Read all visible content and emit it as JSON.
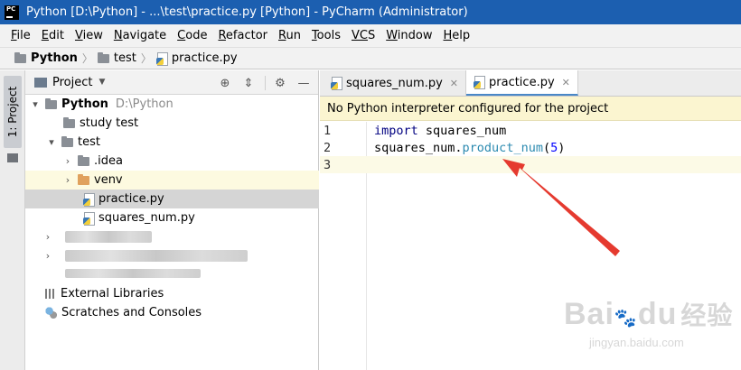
{
  "window": {
    "title": "Python [D:\\Python] - ...\\test\\practice.py [Python] - PyCharm (Administrator)",
    "app_icon_text": "PC"
  },
  "menu": [
    {
      "m": "F",
      "rest": "ile"
    },
    {
      "m": "E",
      "rest": "dit"
    },
    {
      "m": "V",
      "rest": "iew"
    },
    {
      "m": "N",
      "rest": "avigate"
    },
    {
      "m": "C",
      "rest": "ode"
    },
    {
      "m": "R",
      "rest": "efactor"
    },
    {
      "m": "R",
      "rest": "un"
    },
    {
      "m": "T",
      "rest": "ools"
    },
    {
      "m": "VC",
      "rest": "S"
    },
    {
      "m": "W",
      "rest": "indow"
    },
    {
      "m": "H",
      "rest": "elp"
    }
  ],
  "breadcrumb": [
    "Python",
    "test",
    "practice.py"
  ],
  "side_strip": {
    "label": "1: Project"
  },
  "project_panel": {
    "title": "Project",
    "tree": {
      "root": {
        "name": "Python",
        "path": "D:\\Python"
      },
      "study_test": "study test",
      "test": "test",
      "idea": ".idea",
      "venv": "venv",
      "practice": "practice.py",
      "squares": "squares_num.py",
      "external_libraries": "External Libraries",
      "scratches": "Scratches and Consoles"
    }
  },
  "editor": {
    "tabs": [
      {
        "label": "squares_num.py"
      },
      {
        "label": "practice.py"
      }
    ],
    "banner": "No Python interpreter configured for the project",
    "lines": {
      "l1": {
        "num": "1",
        "kw": "import",
        "rest": " squares_num"
      },
      "l2": {
        "num": "2",
        "obj": "squares_num",
        "dot": ".",
        "fn": "product_num",
        "open": "(",
        "arg": "5",
        "close": ")"
      },
      "l3": {
        "num": "3"
      }
    }
  },
  "annotation": {
    "arrow_color": "#e53a2f"
  },
  "watermark": {
    "brand": "Bai",
    "paw": "du",
    "cn": "经验",
    "url": "jingyan.baidu.com"
  }
}
